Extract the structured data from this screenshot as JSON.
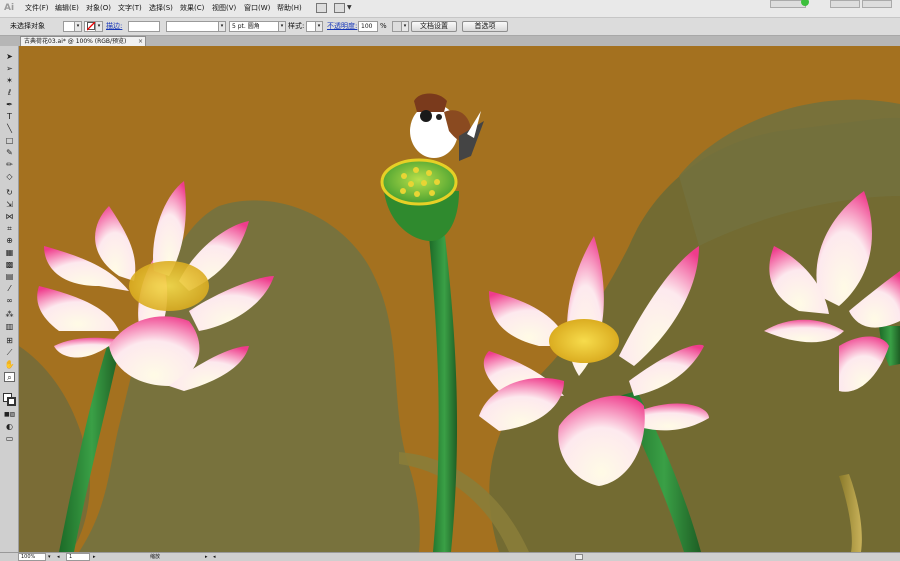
{
  "app": {
    "logo": "Ai"
  },
  "menu": [
    {
      "label": "文件(F)"
    },
    {
      "label": "编辑(E)"
    },
    {
      "label": "对象(O)"
    },
    {
      "label": "文字(T)"
    },
    {
      "label": "选择(S)"
    },
    {
      "label": "效果(C)"
    },
    {
      "label": "视图(V)"
    },
    {
      "label": "窗口(W)"
    },
    {
      "label": "帮助(H)"
    }
  ],
  "control_bar": {
    "selection_status": "未选择对象",
    "stroke_label": "描边:",
    "brush_value": "5 pt. 圆角",
    "style_label": "样式:",
    "opacity_label": "不透明度:",
    "opacity_value": "100",
    "percent_sign": "%",
    "doc_setup_button": "文档设置",
    "preferences_button": "首选项"
  },
  "document_tab": {
    "title": "古典荷花03.ai* @ 100% (RGB/预览)",
    "close": "×"
  },
  "status_bar": {
    "zoom": "100%",
    "page": "1",
    "tool_label": "缩放"
  },
  "colors": {
    "canvas_background": "#a4711f",
    "leaf": "#6b6a36",
    "stem": "#2f8f3a",
    "petal_tip": "#ef3c8c"
  },
  "icons": [
    "selection-tool-icon",
    "direct-selection-tool-icon",
    "magic-wand-icon",
    "lasso-icon",
    "pen-tool-icon",
    "type-tool-icon",
    "line-tool-icon",
    "rectangle-tool-icon",
    "paintbrush-icon",
    "pencil-icon",
    "eraser-icon",
    "rotate-icon",
    "scale-icon",
    "width-tool-icon",
    "free-transform-icon",
    "shape-builder-icon",
    "perspective-grid-icon",
    "mesh-icon",
    "gradient-icon",
    "eyedropper-icon",
    "blend-icon",
    "symbol-sprayer-icon",
    "graph-icon",
    "artboard-icon",
    "slice-icon",
    "hand-icon",
    "zoom-icon"
  ]
}
